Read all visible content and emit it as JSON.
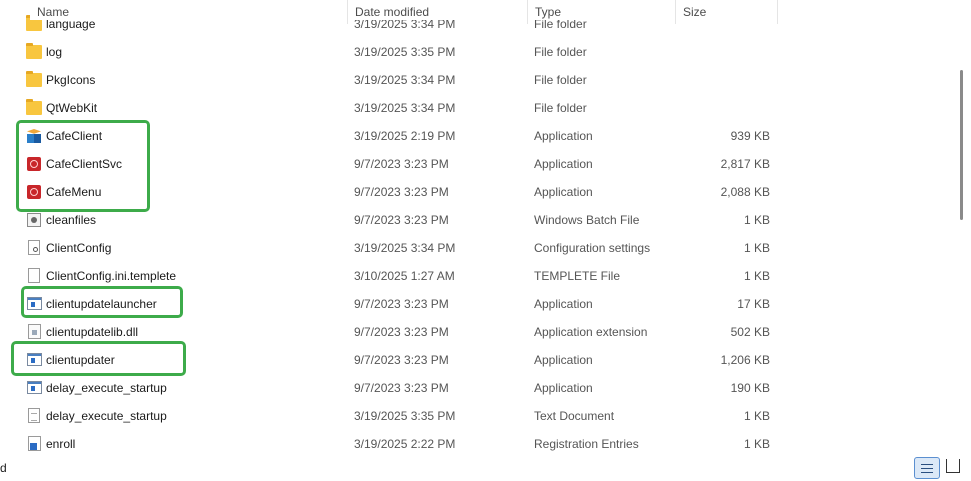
{
  "header": {
    "name_label": "Name",
    "date_label": "Date modified",
    "type_label": "Type",
    "size_label": "Size"
  },
  "files": [
    {
      "name": "language",
      "date": "3/19/2025 3:34 PM",
      "type": "File folder",
      "size": "",
      "icon": "folder-icon"
    },
    {
      "name": "log",
      "date": "3/19/2025 3:35 PM",
      "type": "File folder",
      "size": "",
      "icon": "folder-icon"
    },
    {
      "name": "PkgIcons",
      "date": "3/19/2025 3:34 PM",
      "type": "File folder",
      "size": "",
      "icon": "folder-icon"
    },
    {
      "name": "QtWebKit",
      "date": "3/19/2025 3:34 PM",
      "type": "File folder",
      "size": "",
      "icon": "folder-icon"
    },
    {
      "name": "CafeClient",
      "date": "3/19/2025 2:19 PM",
      "type": "Application",
      "size": "939 KB",
      "icon": "cafe-client-app-icon"
    },
    {
      "name": "CafeClientSvc",
      "date": "9/7/2023 3:23 PM",
      "type": "Application",
      "size": "2,817 KB",
      "icon": "cafe-red-app-icon"
    },
    {
      "name": "CafeMenu",
      "date": "9/7/2023 3:23 PM",
      "type": "Application",
      "size": "2,088 KB",
      "icon": "cafe-red-app-icon"
    },
    {
      "name": "cleanfiles",
      "date": "9/7/2023 3:23 PM",
      "type": "Windows Batch File",
      "size": "1 KB",
      "icon": "batch-file-icon"
    },
    {
      "name": "ClientConfig",
      "date": "3/19/2025 3:34 PM",
      "type": "Configuration settings",
      "size": "1 KB",
      "icon": "config-file-icon"
    },
    {
      "name": "ClientConfig.ini.templete",
      "date": "3/10/2025 1:27 AM",
      "type": "TEMPLETE File",
      "size": "1 KB",
      "icon": "blank-file-icon"
    },
    {
      "name": "clientupdatelauncher",
      "date": "9/7/2023 3:23 PM",
      "type": "Application",
      "size": "17 KB",
      "icon": "exe-window-icon"
    },
    {
      "name": "clientupdatelib.dll",
      "date": "9/7/2023 3:23 PM",
      "type": "Application extension",
      "size": "502 KB",
      "icon": "dll-file-icon"
    },
    {
      "name": "clientupdater",
      "date": "9/7/2023 3:23 PM",
      "type": "Application",
      "size": "1,206 KB",
      "icon": "exe-window-icon"
    },
    {
      "name": "delay_execute_startup",
      "date": "9/7/2023 3:23 PM",
      "type": "Application",
      "size": "190 KB",
      "icon": "exe-window-icon"
    },
    {
      "name": "delay_execute_startup",
      "date": "3/19/2025 3:35 PM",
      "type": "Text Document",
      "size": "1 KB",
      "icon": "text-file-icon"
    },
    {
      "name": "enroll",
      "date": "3/19/2025 2:22 PM",
      "type": "Registration Entries",
      "size": "1 KB",
      "icon": "registry-file-icon"
    }
  ],
  "status": {
    "left_text": "d"
  },
  "colors": {
    "highlight": "#3dab4a",
    "selection_view": "#dbe8f7"
  }
}
